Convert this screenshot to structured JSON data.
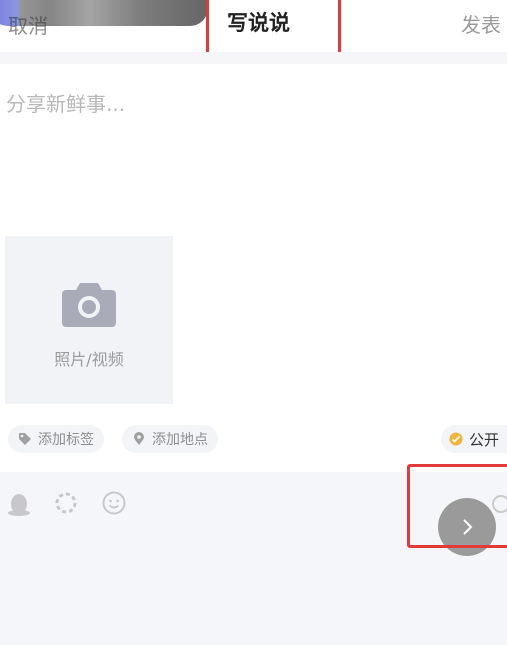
{
  "header": {
    "cancel_label": "取消",
    "title": "写说说",
    "publish_label": "发表"
  },
  "compose": {
    "placeholder": "分享新鲜事..."
  },
  "media": {
    "photo_label": "照片/视频"
  },
  "chips": {
    "tag_label": "添加标签",
    "location_label": "添加地点",
    "visibility_label": "公开"
  },
  "icons": {
    "camera": "camera-icon",
    "tag": "tag-icon",
    "location": "location-pin-icon",
    "visibility": "public-icon",
    "qq": "qq-penguin-icon",
    "loading": "refresh-icon",
    "emoji": "emoji-icon",
    "next": "chevron-right-icon"
  },
  "colors": {
    "highlight": "#e23a3a",
    "tile_bg": "#f2f3f7",
    "visibility_accent": "#f2b53c"
  }
}
